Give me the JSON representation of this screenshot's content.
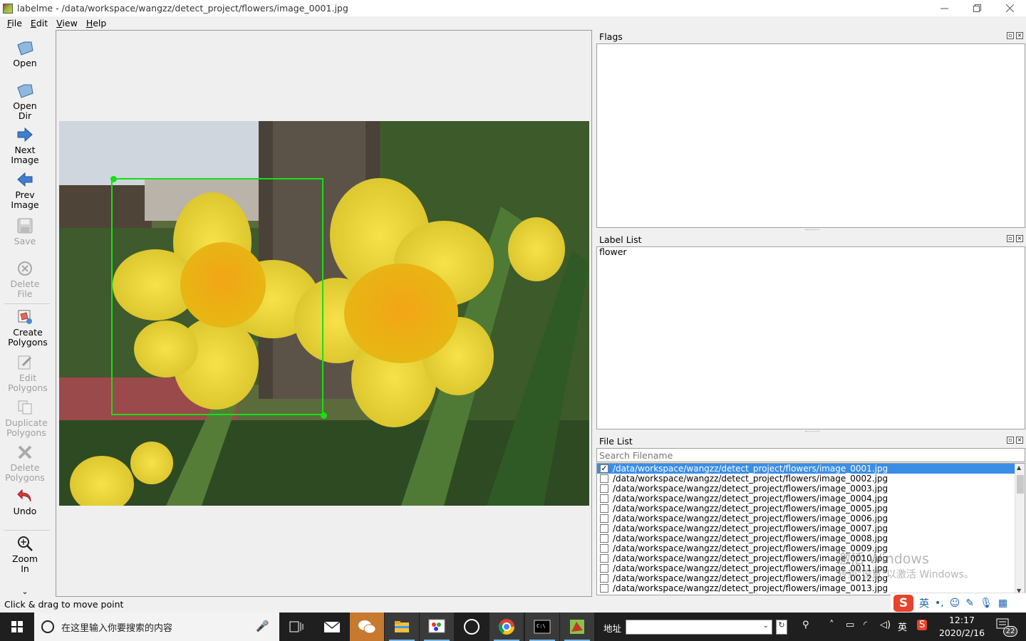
{
  "window": {
    "title": "labelme - /data/workspace/wangzz/detect_project/flowers/image_0001.jpg",
    "buttons": [
      "minimize-icon",
      "restore-icon",
      "close-icon"
    ]
  },
  "menu": {
    "items": [
      {
        "mnemonic": "F",
        "rest": "ile"
      },
      {
        "mnemonic": "E",
        "rest": "dit"
      },
      {
        "mnemonic": "V",
        "rest": "iew"
      },
      {
        "mnemonic": "H",
        "rest": "elp"
      }
    ]
  },
  "toolbar": {
    "open": {
      "label_l1": "Open",
      "icon": "open-icon",
      "enabled": true
    },
    "open_dir": {
      "label_l1": "Open",
      "label_l2": "Dir",
      "icon": "open-dir-icon",
      "enabled": true
    },
    "next_image": {
      "label_l1": "Next",
      "label_l2": "Image",
      "icon": "arrow-right-icon",
      "enabled": true
    },
    "prev_image": {
      "label_l1": "Prev",
      "label_l2": "Image",
      "icon": "arrow-left-icon",
      "enabled": true
    },
    "save": {
      "label_l1": "Save",
      "icon": "save-icon",
      "enabled": false
    },
    "delete_file": {
      "label_l1": "Delete",
      "label_l2": "File",
      "icon": "delete-file-icon",
      "enabled": false
    },
    "create_polygons": {
      "label_l1": "Create",
      "label_l2": "Polygons",
      "icon": "create-polygon-icon",
      "enabled": true
    },
    "edit_polygons": {
      "label_l1": "Edit",
      "label_l2": "Polygons",
      "icon": "edit-polygon-icon",
      "enabled": false
    },
    "duplicate_polygons": {
      "label_l1": "Duplicate",
      "label_l2": "Polygons",
      "icon": "duplicate-icon",
      "enabled": false
    },
    "delete_polygons": {
      "label_l1": "Delete",
      "label_l2": "Polygons",
      "icon": "delete-polygon-icon",
      "enabled": false
    },
    "undo": {
      "label_l1": "Undo",
      "icon": "undo-icon",
      "enabled": true
    },
    "zoom_in": {
      "label_l1": "Zoom",
      "label_l2": "In",
      "icon": "zoom-in-icon",
      "enabled": true
    },
    "more": "⌄"
  },
  "canvas": {
    "shape_color": "#16e016"
  },
  "flags_dock": {
    "title": "Flags"
  },
  "label_dock": {
    "title": "Label List",
    "items": [
      "flower"
    ]
  },
  "file_dock": {
    "title": "File List",
    "search_placeholder": "Search Filename",
    "files": [
      {
        "path": "/data/workspace/wangzz/detect_project/flowers/image_0001.jpg",
        "checked": true,
        "selected": true
      },
      {
        "path": "/data/workspace/wangzz/detect_project/flowers/image_0002.jpg",
        "checked": false
      },
      {
        "path": "/data/workspace/wangzz/detect_project/flowers/image_0003.jpg",
        "checked": false
      },
      {
        "path": "/data/workspace/wangzz/detect_project/flowers/image_0004.jpg",
        "checked": false
      },
      {
        "path": "/data/workspace/wangzz/detect_project/flowers/image_0005.jpg",
        "checked": false
      },
      {
        "path": "/data/workspace/wangzz/detect_project/flowers/image_0006.jpg",
        "checked": false
      },
      {
        "path": "/data/workspace/wangzz/detect_project/flowers/image_0007.jpg",
        "checked": false
      },
      {
        "path": "/data/workspace/wangzz/detect_project/flowers/image_0008.jpg",
        "checked": false
      },
      {
        "path": "/data/workspace/wangzz/detect_project/flowers/image_0009.jpg",
        "checked": false
      },
      {
        "path": "/data/workspace/wangzz/detect_project/flowers/image_0010.jpg",
        "checked": false
      },
      {
        "path": "/data/workspace/wangzz/detect_project/flowers/image_0011.jpg",
        "checked": false
      },
      {
        "path": "/data/workspace/wangzz/detect_project/flowers/image_0012.jpg",
        "checked": false
      },
      {
        "path": "/data/workspace/wangzz/detect_project/flowers/image_0013.jpg",
        "checked": false
      }
    ],
    "selection_color": "#3a8ee6"
  },
  "status": {
    "text": "Click & drag to move point"
  },
  "watermark": {
    "line1": "激活 Windows",
    "line2": "转到\"设置\"以激活 Windows。"
  },
  "ime": {
    "mode": "英",
    "punct": "•,",
    "emoji": "☺",
    "tools": [
      "skin-icon",
      "mic-icon",
      "grid-icon"
    ]
  },
  "taskbar": {
    "search_placeholder": "在这里输入你要搜索的内容",
    "address_label": "地址",
    "address_refresh": "↻",
    "tray_ime": "英",
    "time": "12:17",
    "date": "2020/2/16",
    "notification_count": "22"
  }
}
